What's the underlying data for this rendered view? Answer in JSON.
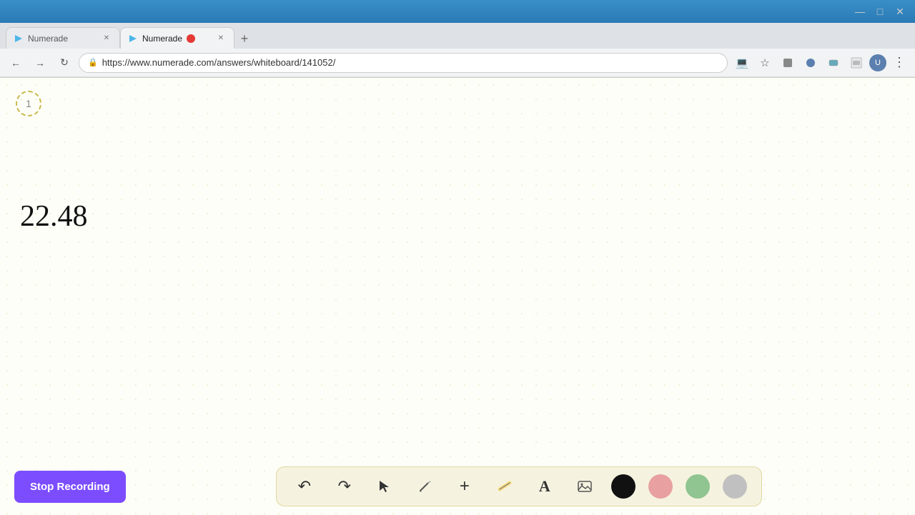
{
  "browser": {
    "title_bar_color": "#3a8fc7",
    "tabs": [
      {
        "id": "tab1",
        "label": "Numerade",
        "active": false,
        "favicon": "numerade",
        "recording": false
      },
      {
        "id": "tab2",
        "label": "Numerade",
        "active": true,
        "favicon": "numerade",
        "recording": true
      }
    ],
    "new_tab_label": "+",
    "address": "https://www.numerade.com/answers/whiteboard/141052/",
    "nav": {
      "back": "←",
      "forward": "→",
      "refresh": "↻"
    }
  },
  "whiteboard": {
    "page_number": "1",
    "content_text": "22.48",
    "background_color": "#fefef8",
    "dot_color": "#d4cc8a"
  },
  "toolbar": {
    "stop_recording_label": "Stop Recording",
    "tools": [
      {
        "id": "undo",
        "icon": "↺",
        "label": "undo"
      },
      {
        "id": "redo",
        "icon": "↻",
        "label": "redo"
      },
      {
        "id": "select",
        "icon": "▲",
        "label": "select"
      },
      {
        "id": "pencil",
        "icon": "✏",
        "label": "pencil"
      },
      {
        "id": "add",
        "icon": "+",
        "label": "add"
      },
      {
        "id": "eraser",
        "icon": "⌫",
        "label": "eraser"
      },
      {
        "id": "text",
        "icon": "A",
        "label": "text"
      },
      {
        "id": "image",
        "icon": "🖼",
        "label": "image"
      }
    ],
    "colors": [
      {
        "id": "black",
        "hex": "#111111"
      },
      {
        "id": "pink",
        "hex": "#e8a0a0"
      },
      {
        "id": "green",
        "hex": "#90c490"
      },
      {
        "id": "gray",
        "hex": "#c0c0c0"
      }
    ]
  },
  "window_controls": {
    "minimize": "—",
    "maximize": "□",
    "close": "✕"
  }
}
